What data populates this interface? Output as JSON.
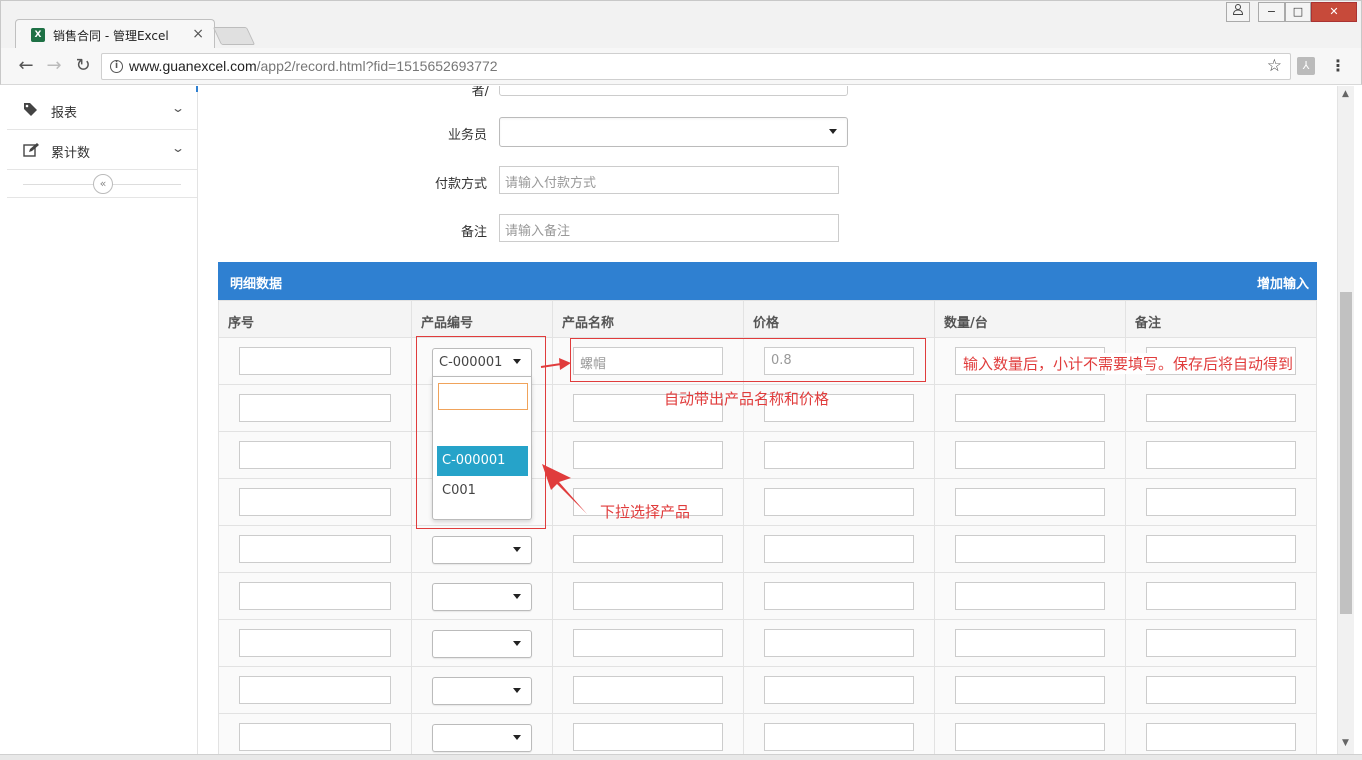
{
  "browser": {
    "tab_title": "销售合同 - 管理Excel",
    "tab_close": "×",
    "url_host": "www.guanexcel.com",
    "url_path": "/app2/record.html?fid=1515652693772",
    "window_buttons": [
      "−",
      "□",
      "✕"
    ]
  },
  "sidebar": {
    "items": [
      {
        "label": "报表",
        "icon": "tag-icon"
      },
      {
        "label": "累计数",
        "icon": "edit-icon"
      }
    ],
    "collapse_symbol": "«"
  },
  "form": {
    "partial_label": "者/",
    "salesman_label": "业务员",
    "payment_label": "付款方式",
    "payment_placeholder": "请输入付款方式",
    "notes_label": "备注",
    "notes_placeholder": "请输入备注"
  },
  "detail": {
    "title": "明细数据",
    "add_input": "增加输入",
    "columns": [
      "序号",
      "产品编号",
      "产品名称",
      "价格",
      "数量/台",
      "备注"
    ],
    "row1": {
      "product_code": "C-000001",
      "product_name": "螺帽",
      "price": "0.8"
    },
    "row_count": 9
  },
  "dropdown": {
    "options": [
      "C-000001",
      "C001"
    ],
    "selected": "C-000001"
  },
  "annotations": {
    "auto_fill": "自动带出产品名称和价格",
    "select_product": "下拉选择产品",
    "quantity_hint": "输入数量后，小计不需要填写。保存后将自动得到"
  },
  "colors": {
    "accent": "#2f80d1",
    "annotation": "#e03c3c",
    "dropdown_active": "#26a3c9"
  }
}
